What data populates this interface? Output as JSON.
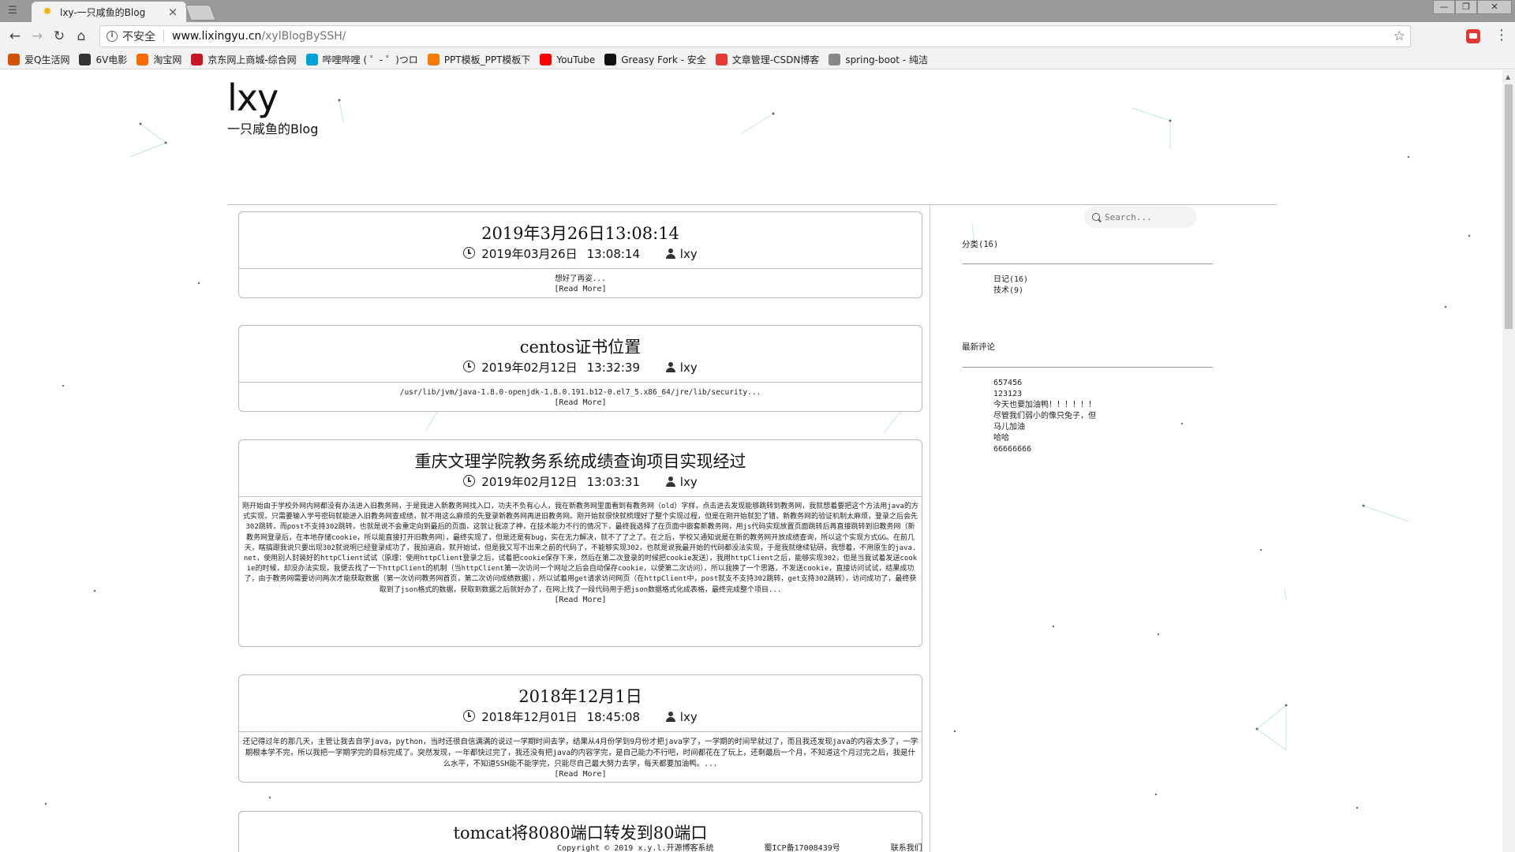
{
  "browser": {
    "tab_title": "lxy-一只咸鱼的Blog",
    "tab_close": "×",
    "security_label": "不安全",
    "url_host": "www.lixingyu.cn",
    "url_path": "/xylBlogBySSH/",
    "bookmarks": [
      {
        "label": "爱Q生活网",
        "icon": "tiger-icon",
        "color": "#d35400"
      },
      {
        "label": "6V电影",
        "icon": "6v-icon",
        "color": "#333333"
      },
      {
        "label": "淘宝网",
        "icon": "taobao-icon",
        "color": "#ff6a00"
      },
      {
        "label": "京东网上商城-综合网",
        "icon": "jd-icon",
        "color": "#c81623"
      },
      {
        "label": "哔哩哔哩 ( ゜- ゜)つロ",
        "icon": "bilibili-icon",
        "color": "#00a1d6"
      },
      {
        "label": "PPT模板_PPT模板下",
        "icon": "ppt-icon",
        "color": "#f57c00"
      },
      {
        "label": "YouTube",
        "icon": "youtube-icon",
        "color": "#ff0000"
      },
      {
        "label": "Greasy Fork - 安全",
        "icon": "greasyfork-icon",
        "color": "#111111"
      },
      {
        "label": "文章管理-CSDN博客",
        "icon": "csdn-icon",
        "color": "#e53935"
      },
      {
        "label": "spring-boot - 纯洁",
        "icon": "cloud-icon",
        "color": "#888888"
      }
    ]
  },
  "site": {
    "title": "lxy",
    "subtitle": "一只咸鱼的Blog"
  },
  "posts": [
    {
      "title": "2019年3月26日13:08:14",
      "date": "2019年03月26日",
      "time": "13:08:14",
      "author": "lxy",
      "excerpt": "想好了再姿...",
      "read_more": "[Read More]"
    },
    {
      "title": "centos证书位置",
      "date": "2019年02月12日",
      "time": "13:32:39",
      "author": "lxy",
      "excerpt": "/usr/lib/jvm/java-1.8.0-openjdk-1.8.0.191.b12-0.el7_5.x86_64/jre/lib/security...",
      "read_more": "[Read More]"
    },
    {
      "title": "重庆文理学院教务系统成绩查询项目实现经过",
      "date": "2019年02月12日",
      "time": "13:03:31",
      "author": "lxy",
      "excerpt": "刚开始由于学校外网内网都没有办法进入旧教务网，于是我进入新教务网找入口，功夫不负有心人，我在新教务网里面看到有教务网（old）字样，点击进去发现能够跳转到教务网，我就想着要把这个方法用java的方式实现，只需要输入学号密码就能进入旧教务网查成绩，就不用这么麻烦的先登录新教务网再进旧教务网。刚开始就很快就梳理好了整个实现过程，但是在刚开始就犯了错，新教务网的验证机制太麻烦，登录之后会先302跳转，而post不支持302跳转，也就是说不会重定向到最后的页面，这就让我凉了神，在技术能力不行的情况下，最终我选择了在页面中嵌套新教务网，用js代码实现放置页面跳转后再直接跳转到旧教务网（新教务网登录后，在本地存储cookie，所以能直接打开旧教务网），最终实现了，但是还是有bug，实在无力解决，就不了了之了。在之后，学校又通知说是在新的教务网开放成绩查询，所以这个实现方式GG。在前几天，瞎搞跟我说只要出现302就说明已经登录成功了，我拍道启，就开始试，但是我又写不出来之前的代码了，不能够实现302，也就是说我最开始的代码都没法实现，于是我就继续钻研，我想着，不用原生的java.net，使用别人封装好的httpClient试试（原理：使用httpClient登录之后，试着把cookie保存下来，然后在第二次登录的时候把cookie发送），我用httpClient之后，能够实现302，但是当我试着发送cookie的时候，却没办法实现，我便去找了一下httpClient的机制（当httpClient第一次访问一个网址之后会自动保存cookie，以便第二次访问），所以我换了一个思路，不发送cookie，直接访问试试，结果成功了，由于教务网需要访问两次才能获取数据（第一次访问教务网首页，第二次访问成绩数据），所以试着用get请求访问网页（在httpClient中，post就支不支持302跳转，get支持302跳转），访问成功了，最终获取到了json格式的数据，获取到数据之后就好办了，在网上找了一段代码用于把json数据格式化成表格，最终完成整个项目...",
      "read_more": "[Read More]"
    },
    {
      "title": "2018年12月1日",
      "date": "2018年12月01日",
      "time": "18:45:08",
      "author": "lxy",
      "excerpt": "还记得过年的那几天，主管让我去自学java，python，当时还很自信满满的说过一学期时间去学，结果从4月份学到9月份才把java学了，一学期的时间早就过了，而且我还发现java的内容太多了，一学期根本学不完，所以我把一学期学完的目标完成了。突然发现，一年都快过完了，我还没有把java的内容学完，是自己能力不行吧，时间都花在了玩上，还剩最后一个月，不知道这个月过完之后，我是什么水平，不知道SSH能不能学完，只能尽自己最大努力去学，每天都要加油鸭。...",
      "read_more": "[Read More]"
    },
    {
      "title": "tomcat将8080端口转发到80端口"
    }
  ],
  "sidebar": {
    "search_placeholder": "Search...",
    "categories_heading": "分类(16)",
    "categories": [
      "日记(16)",
      "技术(9)"
    ],
    "comments_heading": "最新评论",
    "comments": [
      "657456",
      "123123",
      "今天也要加油鸭！！！！！！",
      "尽管我们弱小的像只兔子，但",
      "马儿加油",
      "哈哈",
      "66666666"
    ]
  },
  "footer": {
    "copyright": "Copyright © 2019 x.y.l.开源博客系统",
    "icp": "蜀ICP备17008439号",
    "contact": "联系我们"
  }
}
